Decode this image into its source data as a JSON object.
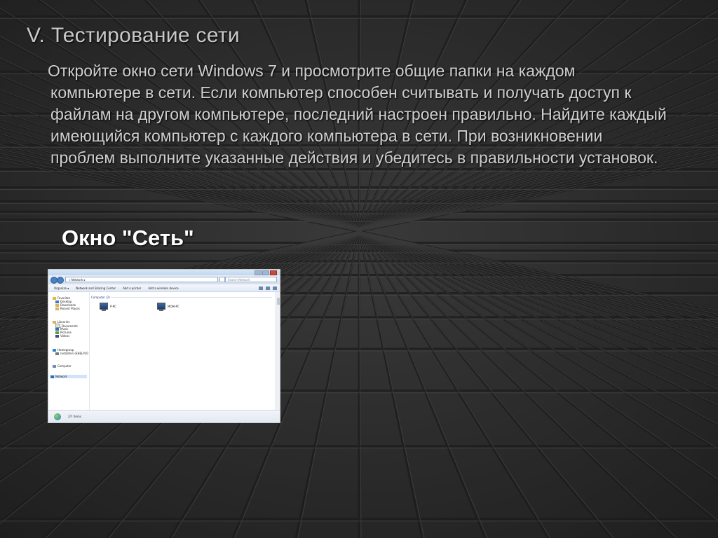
{
  "slide": {
    "title": "V. Тестирование сети",
    "body": "Откройте окно сети Windows 7 и просмотрите общие папки на каждом компьютере в сети. Если компьютер способен считывать и получать доступ к файлам на другом компьютере, последний настроен правильно. Найдите каждый имеющийся компьютер с каждого компьютера в сети. При возникновении проблем выполните указанные действия и убедитесь в правильности установок.",
    "caption": "Окно \"Сеть\""
  },
  "screenshot": {
    "address": "« Network ▸",
    "search_placeholder": "Search Network",
    "toolbar": {
      "organize": "Organize ▾",
      "network_sharing_center": "Network and Sharing Center",
      "add_printer": "Add a printer",
      "add_wireless_device": "Add a wireless device"
    },
    "nav": {
      "favorites": "Favorites",
      "desktop": "Desktop",
      "downloads": "Downloads",
      "recent_places": "Recent Places",
      "libraries": "Libraries",
      "documents": "Documents",
      "music": "Music",
      "pictures": "Pictures",
      "videos": "Videos",
      "homegroup": "Homegroup",
      "homegroup_user": "notadmin (EHELP10",
      "computer": "Computer",
      "network": "Network"
    },
    "group_header": "Computer (2)",
    "computers": [
      "P-PC",
      "MOM-PC"
    ],
    "status": "2/7 items"
  },
  "colors": {
    "background": "#2c2c2c",
    "title_text": "#c9c9c9",
    "body_text": "#cfcfcf",
    "caption_text": "#ffffff"
  }
}
